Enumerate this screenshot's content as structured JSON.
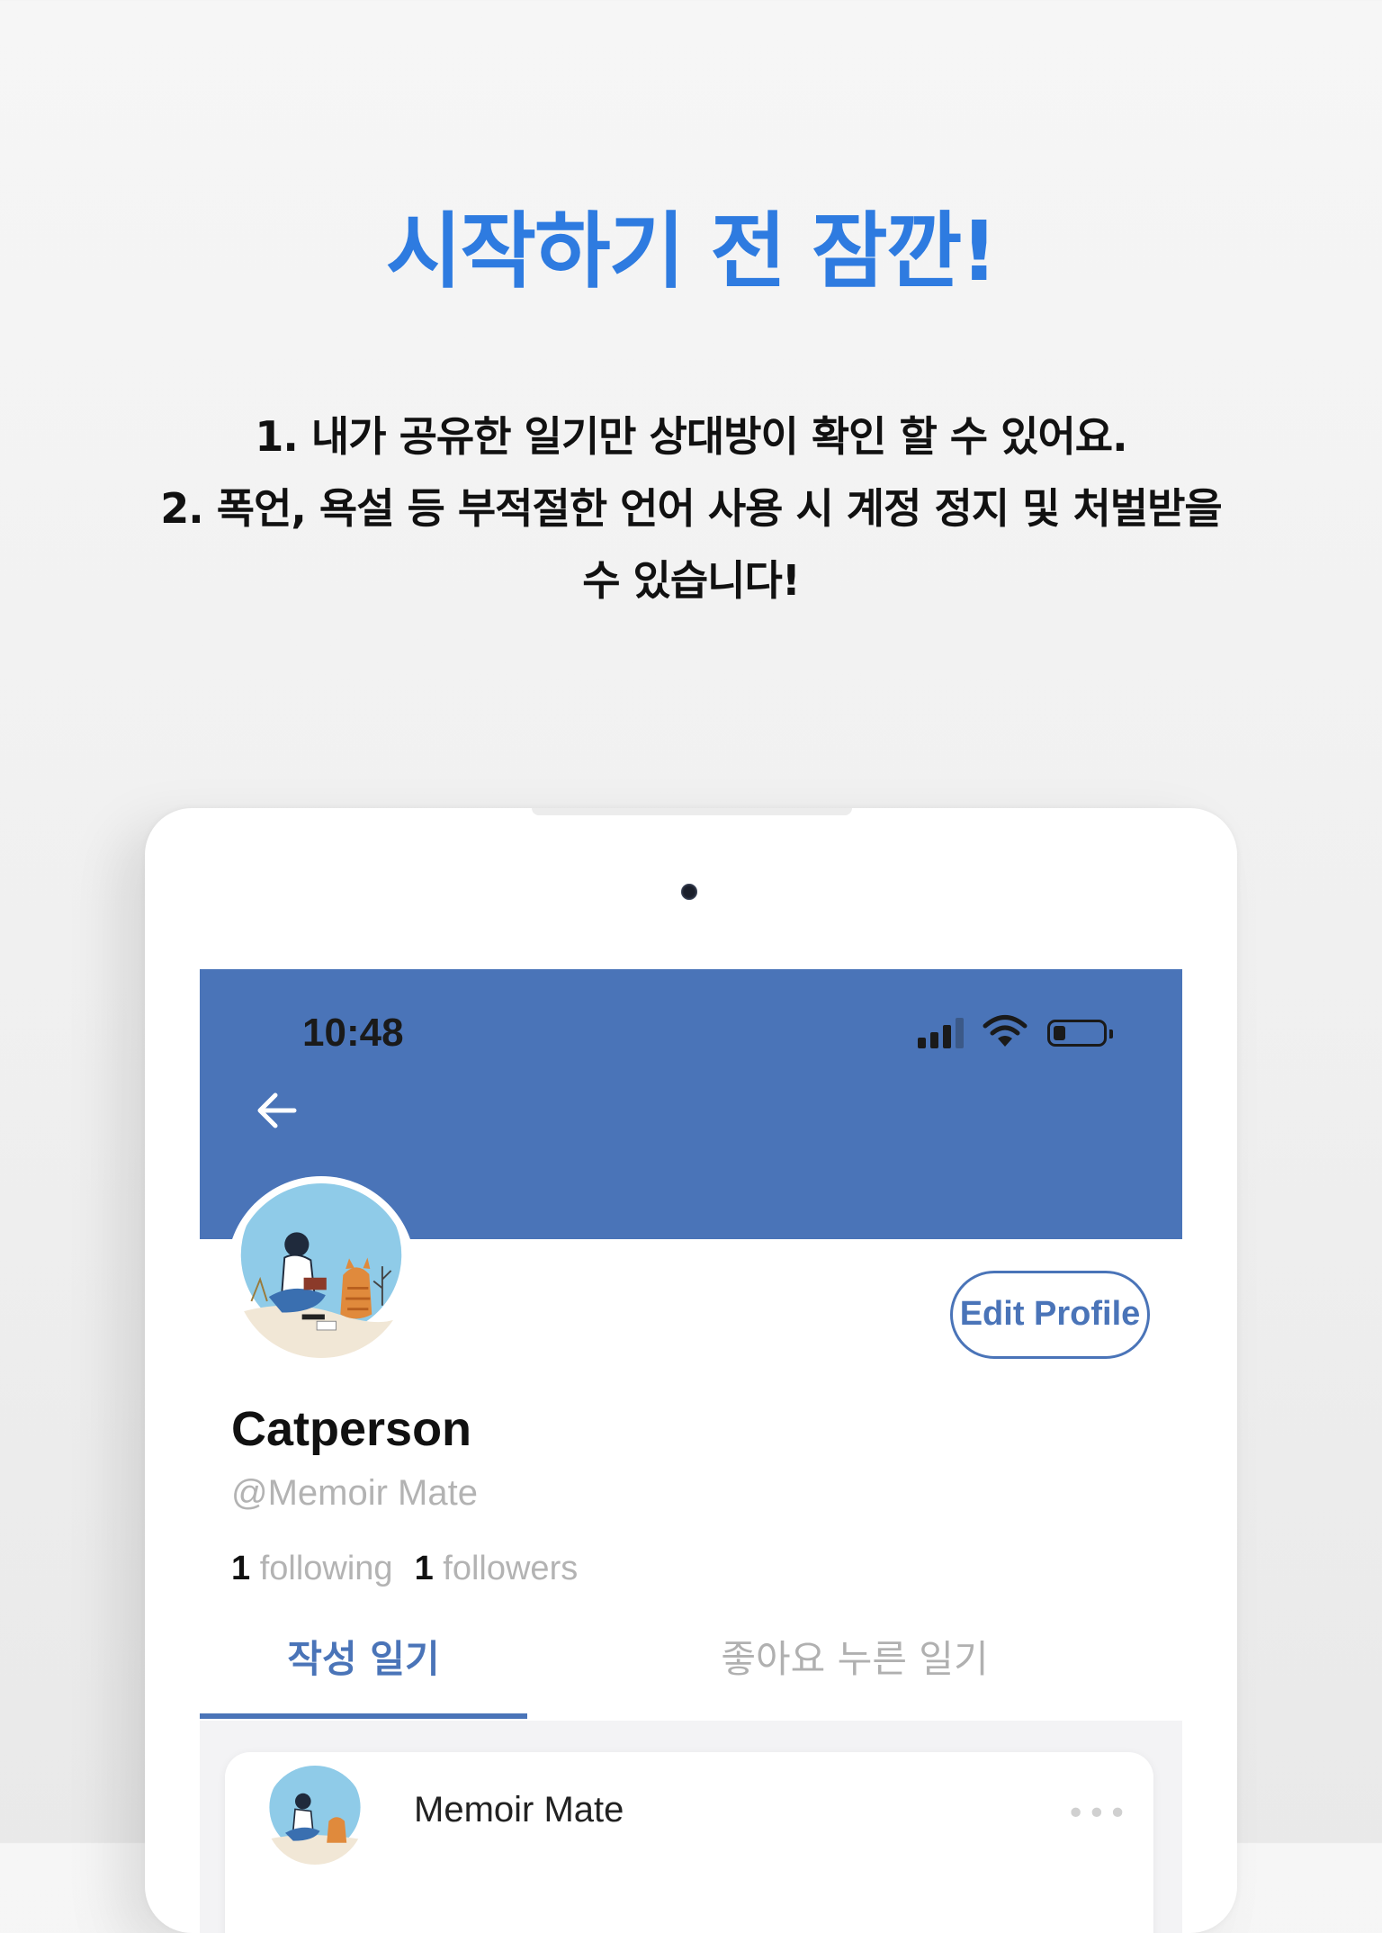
{
  "headline": "시작하기 전 잠깐!",
  "notice": {
    "line1": "1. 내가 공유한 일기만 상대방이 확인 할 수 있어요.",
    "line2": "2. 폭언, 욕설 등 부적절한 언어 사용 시 계정 정지 및 처벌받을",
    "line3": "수 있습니다!"
  },
  "status_bar": {
    "time": "10:48"
  },
  "profile": {
    "edit_button": "Edit Profile",
    "name": "Catperson",
    "handle": "@Memoir Mate",
    "following_count": "1",
    "following_label": "following",
    "followers_count": "1",
    "followers_label": "followers"
  },
  "tabs": [
    {
      "label": "작성 일기",
      "active": true
    },
    {
      "label": "좋아요 누른 일기",
      "active": false
    }
  ],
  "feed": [
    {
      "author": "Memoir Mate",
      "more": "•••"
    }
  ],
  "colors": {
    "accent": "#4a74b8",
    "headline": "#2e7be0"
  },
  "icons": [
    "back-arrow-icon",
    "cellular-signal-icon",
    "wifi-icon",
    "battery-icon",
    "more-icon"
  ]
}
